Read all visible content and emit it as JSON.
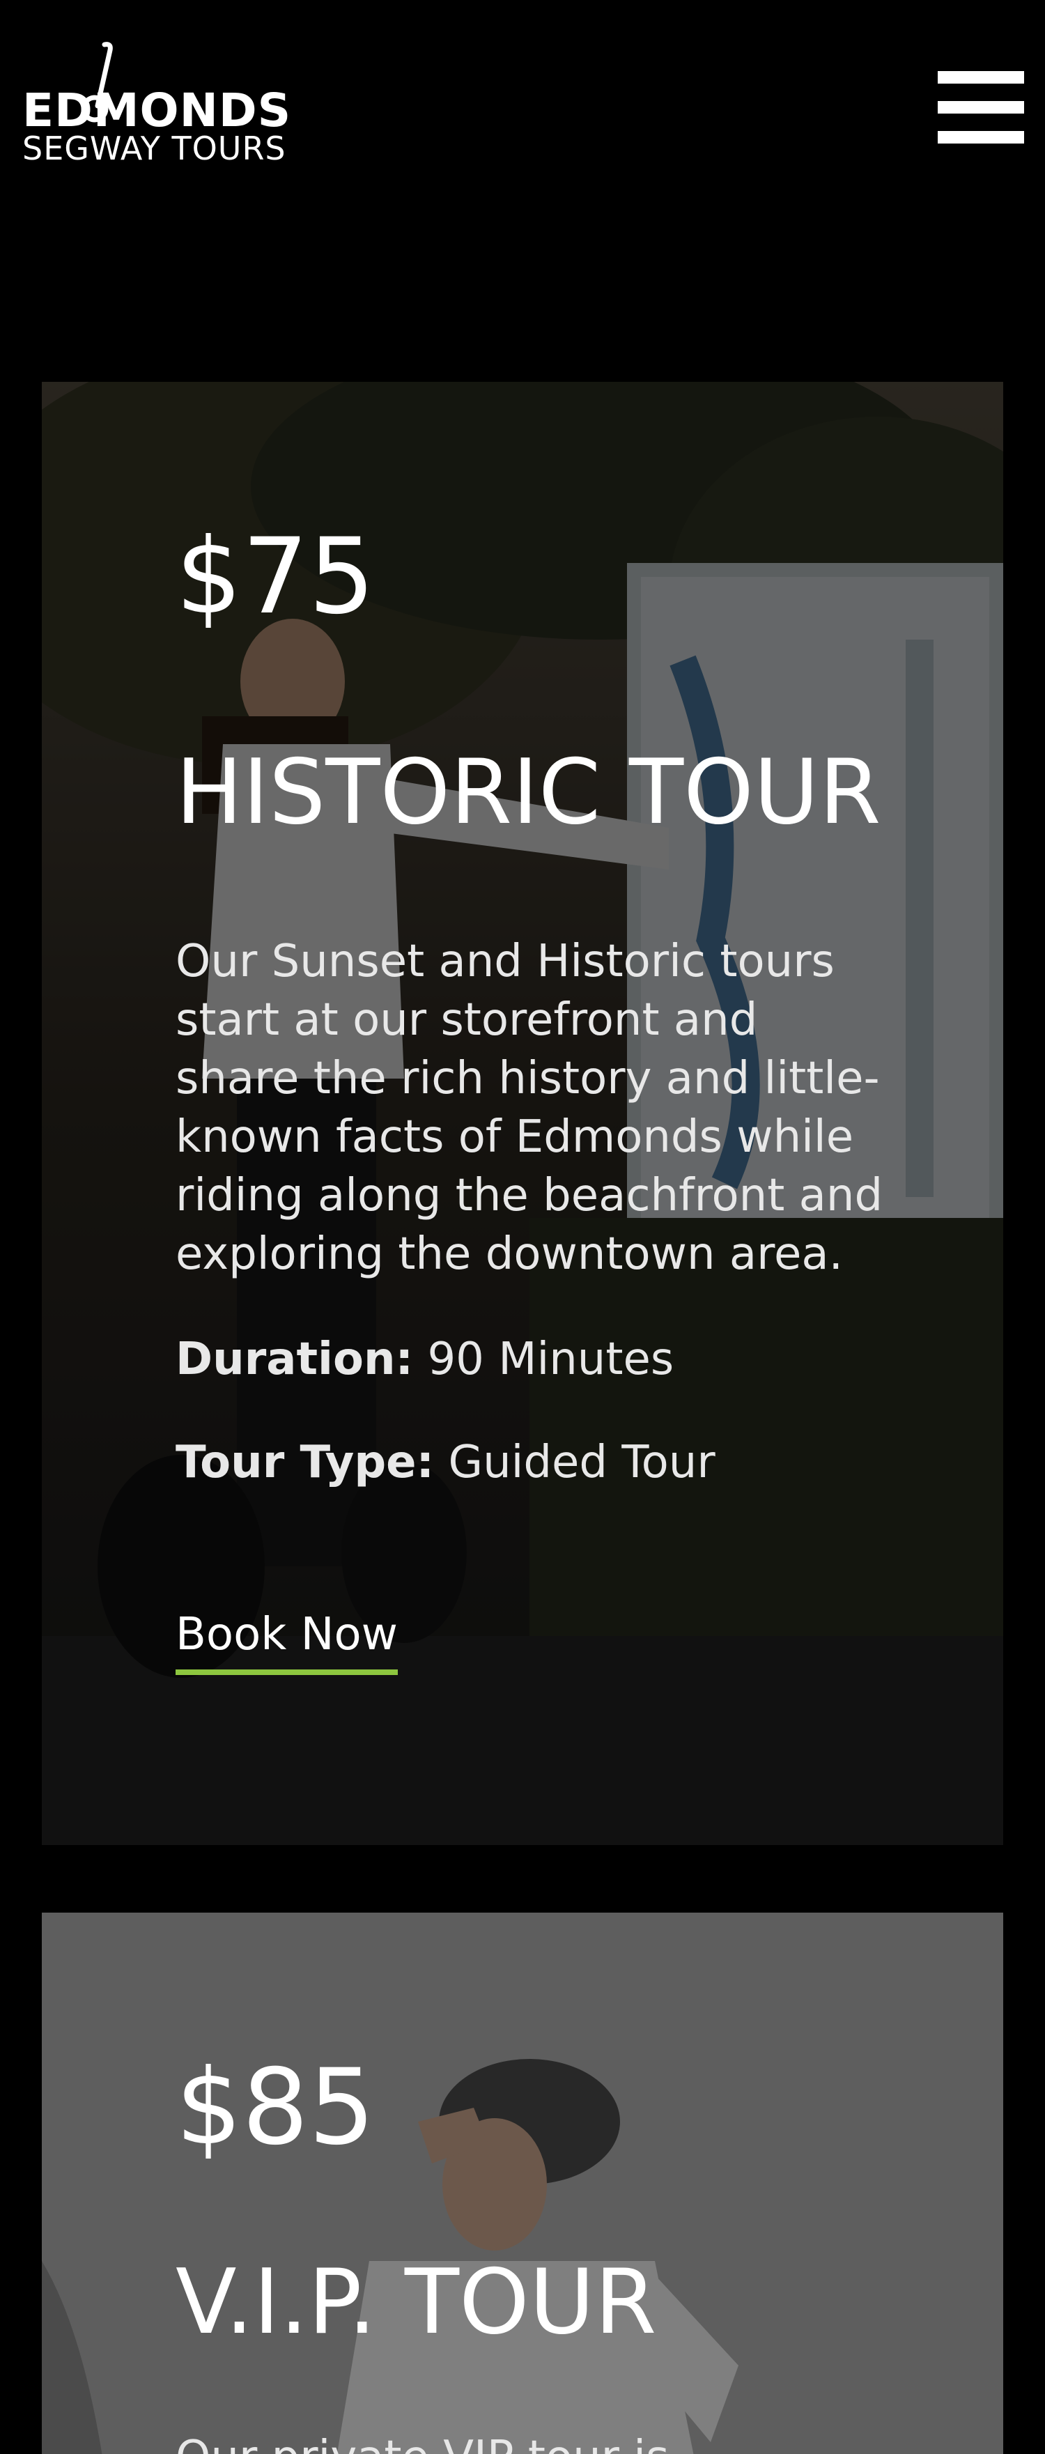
{
  "header": {
    "logo": {
      "line1": "EDMONDS",
      "line2": "SEGWAY TOURS",
      "icon": "segway-logo-icon"
    },
    "menu_icon": "hamburger-menu-icon"
  },
  "tours": [
    {
      "price": "$75",
      "title": "HISTORIC TOUR",
      "description": "Our Sunset and Historic tours start at our storefront and share the rich history and little-known facts of Edmonds while riding along the beachfront and exploring the downtown area.",
      "duration_label": "Duration:",
      "duration_value": "90 Minutes",
      "type_label": "Tour Type:",
      "type_value": "Guided Tour",
      "cta": "Book Now"
    },
    {
      "price": "$85",
      "title": "V.I.P. TOUR",
      "description_partial": "Our private VIP tour is"
    }
  ],
  "colors": {
    "background": "#000000",
    "text": "#ffffff",
    "accent_underline": "#8dc63f",
    "card2_tint": "#4a4a4a"
  }
}
